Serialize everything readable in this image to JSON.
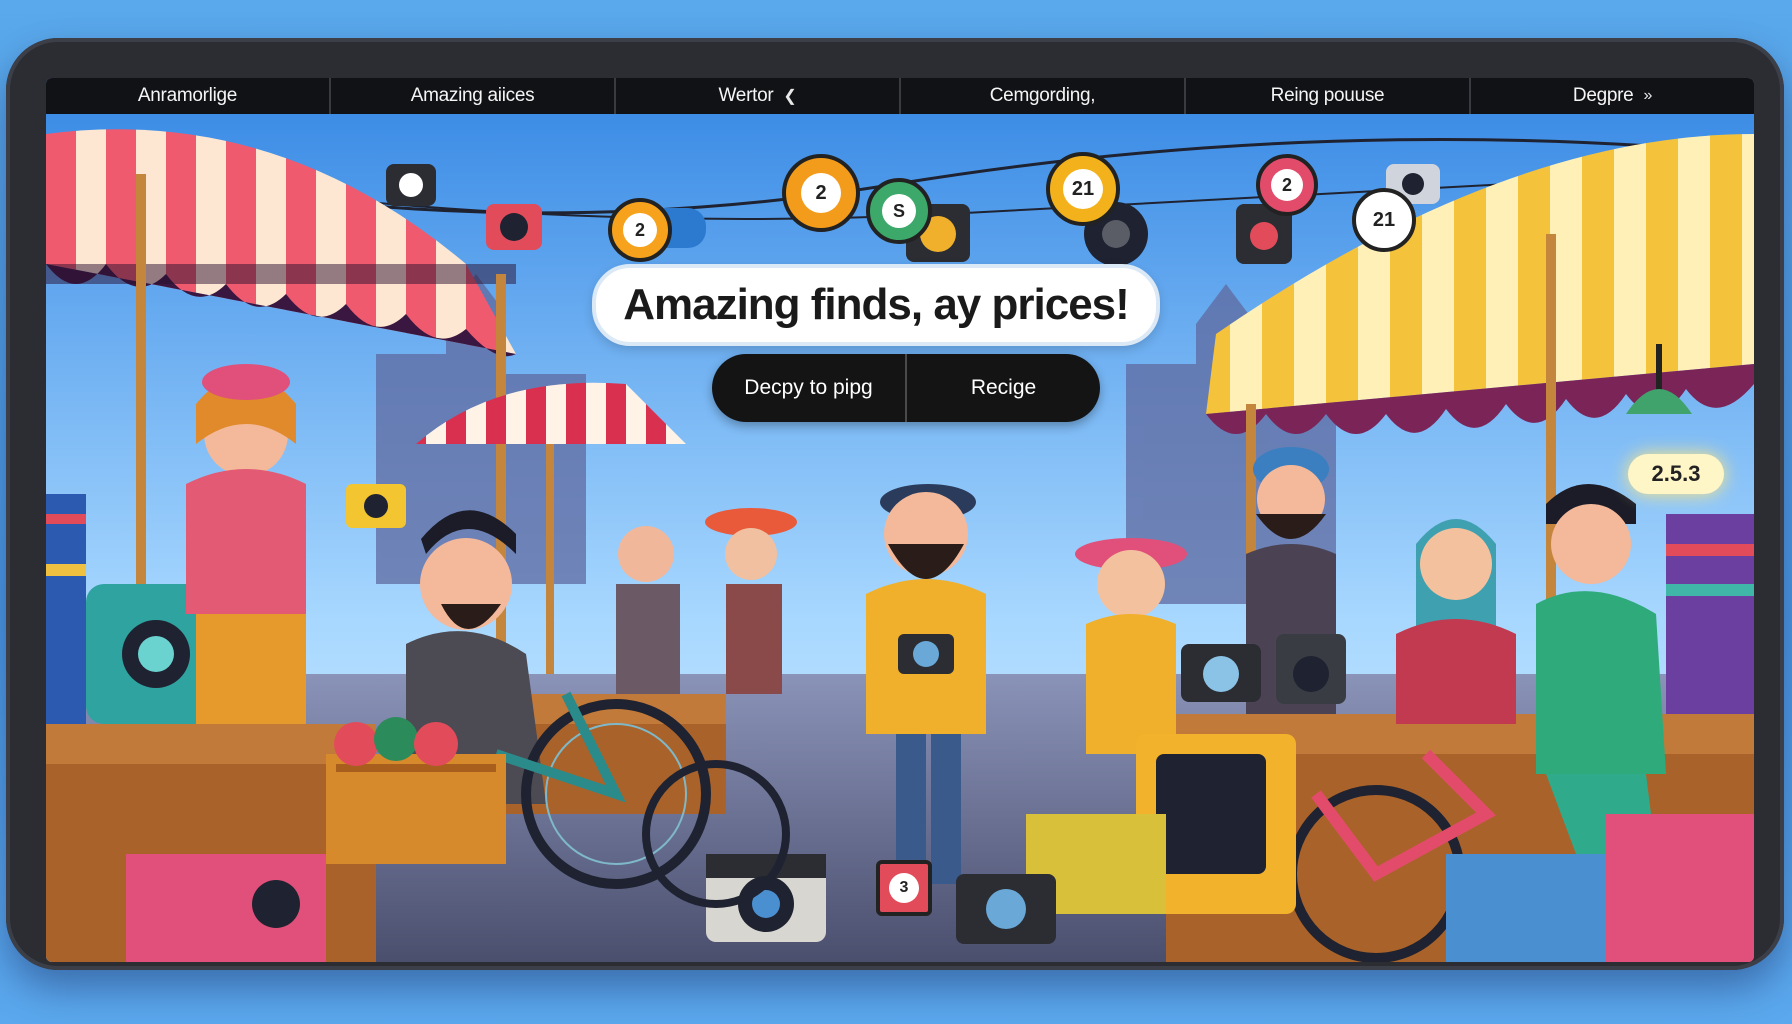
{
  "nav": {
    "items": [
      {
        "label": "Anramorlige"
      },
      {
        "label": "Amazing aiices"
      },
      {
        "label": "Wertor",
        "icon": "chevron-icon"
      },
      {
        "label": "Cemgording,"
      },
      {
        "label": "Reing pouuse"
      },
      {
        "label": "Degpre",
        "icon": "double-chevron-icon"
      }
    ]
  },
  "hero": {
    "headline": "Amazing finds, ay prices!",
    "cta_primary": "Decpy to pipg",
    "cta_secondary": "Recige"
  },
  "price_tags": [
    "2",
    "2",
    "S",
    "21",
    "2",
    "21",
    "3"
  ],
  "price_lamp": "2.5.3",
  "colors": {
    "background": "#4c9be6",
    "navbar": "#111216",
    "button": "#141414",
    "left_awning_stripe": "#ef5a6f",
    "right_awning_stripe": "#f5c23c"
  }
}
